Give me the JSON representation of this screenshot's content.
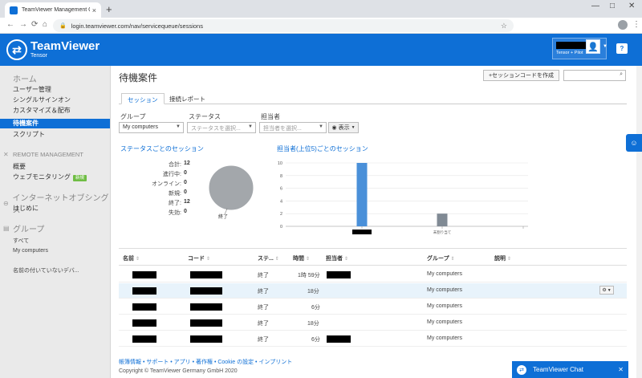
{
  "browser": {
    "tab_title": "TeamViewer Management Conso",
    "tab_close": "×",
    "new_tab": "+",
    "url": "login.teamviewer.com/nav/servicequeue/sessions",
    "minimize": "—",
    "maximize": "□",
    "close": "✕",
    "back": "←",
    "forward": "→",
    "reload": "⟳",
    "home": "⌂",
    "star": "☆",
    "lock_icon": "🔒",
    "menu": "⋮"
  },
  "header": {
    "logo": "TeamViewer",
    "logo_sub": "Tensor",
    "license": "Tensor + Pilot",
    "help": "?"
  },
  "sidebar": {
    "home": "ホーム",
    "home_items": [
      "ユーザー管理",
      "シングルサインオン",
      "カスタマイズ＆配布",
      "待機案件",
      "スクリプト"
    ],
    "remote_management": "REMOTE MANAGEMENT",
    "remote_items": [
      "概要",
      "ウェブモニタリング"
    ],
    "new_badge": "新規",
    "internet_of_things": "インターネットオブシングス",
    "iot_items": [
      "はじめに"
    ],
    "groups": "グループ",
    "group_items": [
      "すべて",
      "My computers"
    ],
    "unnamed_device": "名前の付いていないデバ..."
  },
  "main": {
    "title": "待機案件",
    "create_button": "セッションコードを作成",
    "search_placeholder": "",
    "tabs": [
      "セッション",
      "接続レポート"
    ],
    "filters": {
      "group_label": "グループ",
      "group_value": "My computers",
      "status_label": "ステータス",
      "status_placeholder": "ステータスを選択...",
      "assignee_label": "担当者",
      "assignee_placeholder": "担当者を選択...",
      "view_button": "表示"
    },
    "status_section_title": "ステータスごとのセッション",
    "assignee_section_title": "担当者(上位5)ごとのセッション",
    "stats": [
      {
        "label": "合計:",
        "value": "12"
      },
      {
        "label": "進行中:",
        "value": "0"
      },
      {
        "label": "オンライン:",
        "value": "0"
      },
      {
        "label": "新規:",
        "value": "0"
      },
      {
        "label": "終了:",
        "value": "12"
      },
      {
        "label": "失効:",
        "value": "0"
      }
    ],
    "table": {
      "headers": [
        "名前",
        "コード",
        "ステ...",
        "時間",
        "担当者",
        "グループ",
        "説明"
      ],
      "rows": [
        {
          "status": "終了",
          "time": "1時 59分",
          "group": "My computers"
        },
        {
          "status": "終了",
          "time": "18分",
          "group": "My computers"
        },
        {
          "status": "終了",
          "time": "6分",
          "group": "My computers"
        },
        {
          "status": "終了",
          "time": "18分",
          "group": "My computers"
        },
        {
          "status": "終了",
          "time": "6分",
          "group": "My computers"
        }
      ]
    },
    "footer_links": "帳簿情報 • サポート • アプリ • 著作権 • Cookie の設定 • インプリント",
    "copyright": "Copyright © TeamViewer Germany GmbH 2020"
  },
  "chat": {
    "label": "TeamViewer Chat"
  },
  "colors": {
    "brand": "#0e6fd6",
    "bar_primary": "#4a90d9",
    "bar_secondary": "#808a94",
    "pie": "#a3a7ab"
  },
  "chart_data": [
    {
      "type": "pie",
      "categories": [
        "終了"
      ],
      "values": [
        12
      ]
    },
    {
      "type": "bar",
      "categories": [
        "",
        "未割り当て"
      ],
      "series": [
        {
          "values": [
            10,
            2
          ]
        }
      ],
      "ylim": [
        0,
        10
      ],
      "yticks": [
        0,
        2,
        4,
        6,
        8,
        10
      ],
      "grid": true
    }
  ]
}
